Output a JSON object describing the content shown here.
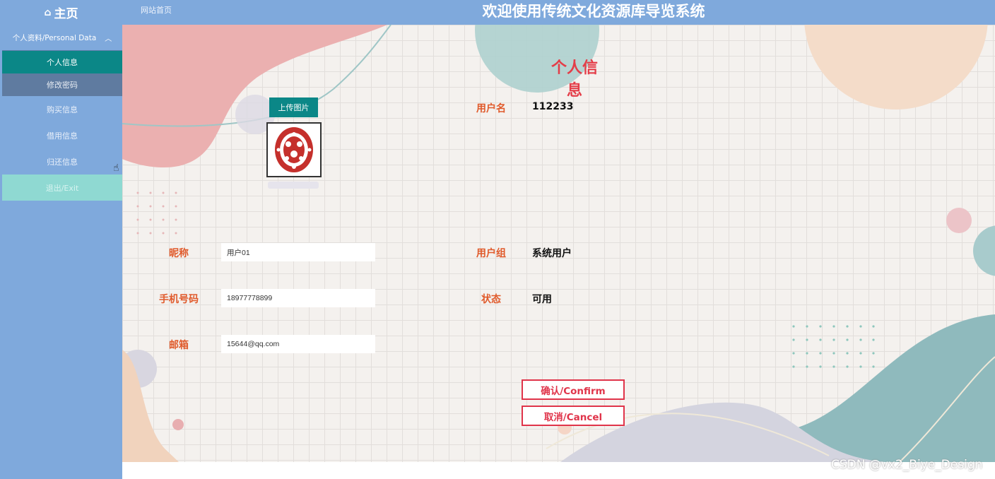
{
  "header": {
    "home_label": "主页",
    "home_icon": "home-icon",
    "site_link": "网站首页",
    "title": "欢迎使用传统文化资源库导览系统"
  },
  "sidebar": {
    "group_label": "个人资料/Personal Data",
    "items": [
      {
        "label": "个人信息",
        "active": true
      },
      {
        "label": "修改密码"
      },
      {
        "label": "购买信息"
      },
      {
        "label": "借用信息"
      },
      {
        "label": "归还信息"
      },
      {
        "label": "退出/Exit"
      }
    ]
  },
  "profile": {
    "title": "个人信息",
    "upload_label": "上传图片",
    "username_label": "用户名",
    "username_value": "112233",
    "nickname_label": "昵称",
    "nickname_value": "用户01",
    "phone_label": "手机号码",
    "phone_value": "18977778899",
    "email_label": "邮箱",
    "email_value": "15644@qq.com",
    "group_label": "用户组",
    "group_value": "系统用户",
    "status_label": "状态",
    "status_value": "可用",
    "confirm_label": "确认/Confirm",
    "cancel_label": "取消/Cancel"
  },
  "watermark": "CSDN @vx2_Biye_Design",
  "colors": {
    "accent": "#0b8787",
    "nav_bg": "#7fa9dc",
    "title_red": "#e43d48",
    "label_orange": "#e05a2b"
  }
}
